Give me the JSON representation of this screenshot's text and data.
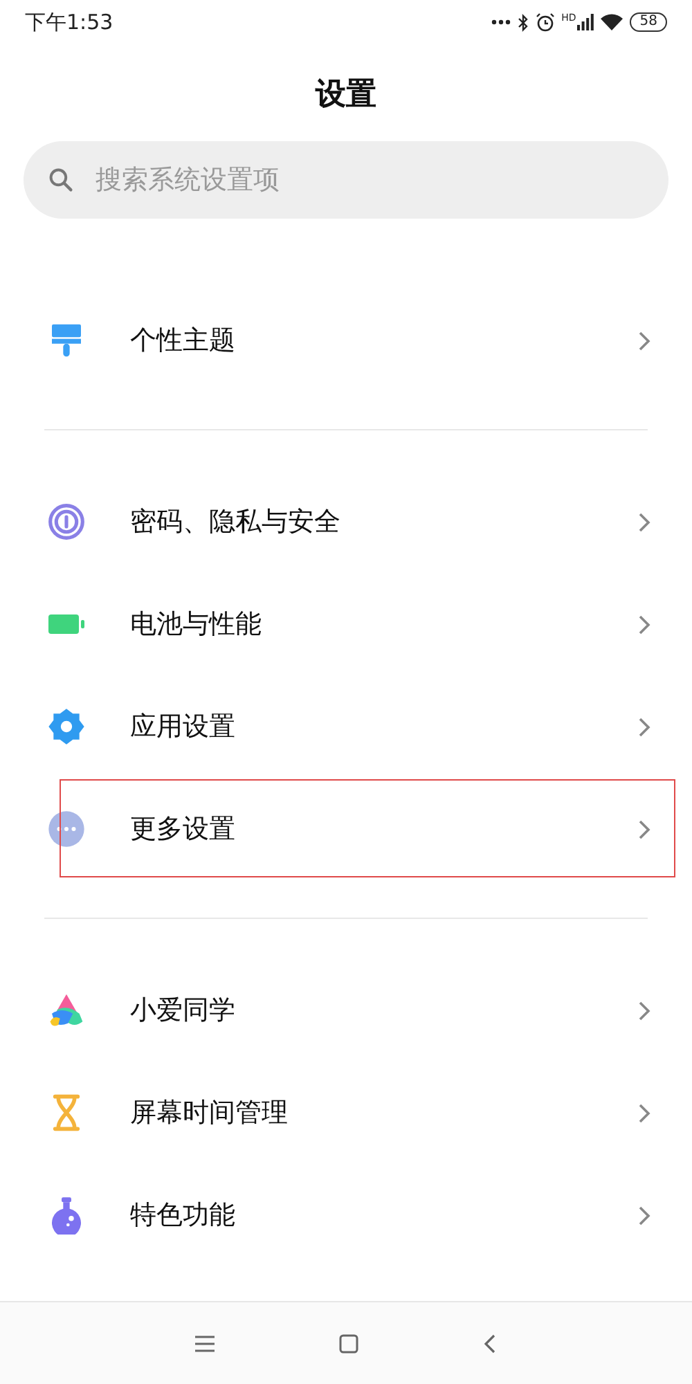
{
  "status_bar": {
    "time": "下午1:53",
    "network_label": "HD",
    "battery": "58"
  },
  "title": "设置",
  "search": {
    "placeholder": "搜索系统设置项"
  },
  "sections": [
    {
      "items": [
        {
          "kind": "theme",
          "label": "个性主题",
          "highlighted": false
        }
      ]
    },
    {
      "items": [
        {
          "kind": "privacy",
          "label": "密码、隐私与安全",
          "highlighted": false
        },
        {
          "kind": "battery",
          "label": "电池与性能",
          "highlighted": false
        },
        {
          "kind": "apps",
          "label": "应用设置",
          "highlighted": false
        },
        {
          "kind": "more",
          "label": "更多设置",
          "highlighted": true
        }
      ]
    },
    {
      "items": [
        {
          "kind": "assistant",
          "label": "小爱同学",
          "highlighted": false
        },
        {
          "kind": "screentime",
          "label": "屏幕时间管理",
          "highlighted": false
        },
        {
          "kind": "features",
          "label": "特色功能",
          "highlighted": false
        }
      ]
    }
  ]
}
